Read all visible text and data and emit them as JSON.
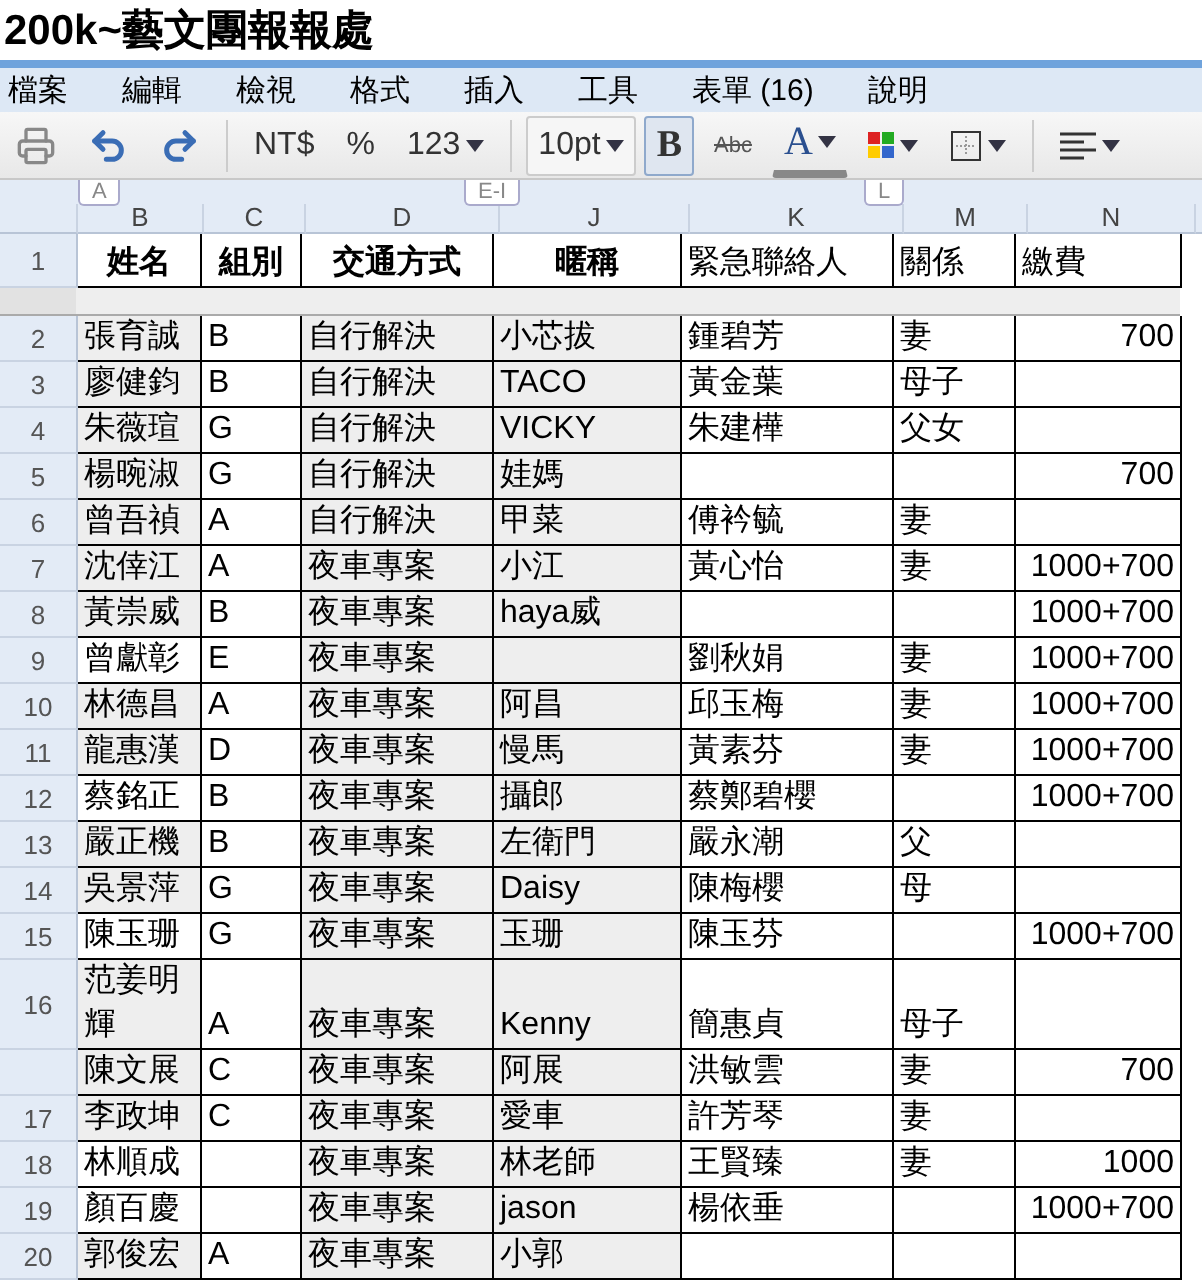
{
  "document_title": "200k~藝文團報報處",
  "menu": [
    "檔案",
    "編輯",
    "檢視",
    "格式",
    "插入",
    "工具",
    "表單 (16)",
    "說明"
  ],
  "toolbar": {
    "currency": "NT$",
    "percent": "%",
    "number_format": "123",
    "font_size": "10pt",
    "bold": {
      "label": "B",
      "selected": true
    },
    "strikethrough": "Abc",
    "text_color": "A"
  },
  "columns": [
    "B",
    "C",
    "D",
    "J",
    "K",
    "M",
    "N"
  ],
  "hidden_column_tabs": [
    "A",
    "E-I",
    "L"
  ],
  "header_row": {
    "number": "1",
    "cells": [
      {
        "text": "姓名",
        "bold": true
      },
      {
        "text": "組別",
        "bold": true
      },
      {
        "text": "交通方式",
        "bold": true
      },
      {
        "text": "暱稱",
        "bold": true
      },
      {
        "text": "緊急聯絡人",
        "bold": false
      },
      {
        "text": "關係",
        "bold": false
      },
      {
        "text": "繳費",
        "bold": false
      }
    ]
  },
  "rows": [
    {
      "number": "2",
      "name_shaded": true,
      "cells": [
        "張育誠",
        "B",
        "自行解決",
        "小芯拔",
        "鍾碧芳",
        "妻",
        "700"
      ]
    },
    {
      "number": "3",
      "name_shaded": true,
      "cells": [
        "廖健鈞",
        "B",
        "自行解決",
        "TACO",
        "黃金葉",
        "母子",
        null
      ]
    },
    {
      "number": "4",
      "name_shaded": true,
      "cells": [
        "朱薇瑄",
        "G",
        "自行解決",
        "VICKY",
        "朱建樺",
        "父女",
        null
      ]
    },
    {
      "number": "5",
      "name_shaded": true,
      "cells": [
        "楊晼淑",
        "G",
        "自行解決",
        "娃媽",
        null,
        null,
        "700"
      ]
    },
    {
      "number": "6",
      "name_shaded": true,
      "cells": [
        "曾吾禎",
        "A",
        "自行解決",
        "甲菜",
        "傅衿毓",
        "妻",
        null
      ]
    },
    {
      "number": "7",
      "name_shaded": true,
      "cells": [
        "沈倖江",
        "A",
        "夜車專案",
        "小江",
        "黃心怡",
        "妻",
        "1000+700"
      ]
    },
    {
      "number": "8",
      "name_shaded": true,
      "cells": [
        "黃崇威",
        "B",
        "夜車專案",
        "haya威",
        null,
        null,
        "1000+700"
      ]
    },
    {
      "number": "9",
      "name_shaded": false,
      "cells": [
        "曾獻彰",
        "E",
        "夜車專案",
        null,
        "劉秋娟",
        "妻",
        "1000+700"
      ]
    },
    {
      "number": "10",
      "name_shaded": true,
      "cells": [
        "林德昌",
        "A",
        "夜車專案",
        "阿昌",
        "邱玉梅",
        "妻",
        "1000+700"
      ]
    },
    {
      "number": "11",
      "name_shaded": true,
      "cells": [
        "龍惠漢",
        "D",
        "夜車專案",
        "慢馬",
        "黃素芬",
        "妻",
        "1000+700"
      ]
    },
    {
      "number": "12",
      "name_shaded": false,
      "cells": [
        "蔡銘正",
        "B",
        "夜車專案",
        "攝郎",
        "蔡鄭碧櫻",
        null,
        "1000+700"
      ]
    },
    {
      "number": "13",
      "name_shaded": true,
      "cells": [
        "嚴正機",
        "B",
        "夜車專案",
        "左衛門",
        "嚴永潮",
        "父",
        null
      ]
    },
    {
      "number": "14",
      "name_shaded": true,
      "cells": [
        "吳景萍",
        "G",
        "夜車專案",
        "Daisy",
        "陳梅櫻",
        "母",
        null
      ]
    },
    {
      "number": "15",
      "name_shaded": false,
      "cells": [
        "陳玉珊",
        "G",
        "夜車專案",
        "玉珊",
        "陳玉芬",
        null,
        "1000+700"
      ]
    },
    {
      "number": "16",
      "name_shaded": true,
      "cells": [
        "范姜明輝",
        "A",
        "夜車專案",
        "Kenny",
        "簡惠貞",
        "母子",
        null
      ]
    },
    {
      "name_shaded": true,
      "cells": [
        "陳文展",
        "C",
        "夜車專案",
        "阿展",
        "洪敏雲",
        "妻",
        "700"
      ]
    },
    {
      "number": "17",
      "name_shaded": true,
      "cells": [
        "李政坤",
        "C",
        "夜車專案",
        "愛車",
        "許芳琴",
        "妻",
        null
      ]
    },
    {
      "number": "18",
      "name_shaded": false,
      "cells": [
        "林順成",
        null,
        "夜車專案",
        "林老師",
        "王賢臻",
        "妻",
        "1000"
      ]
    },
    {
      "number": "19",
      "name_shaded": false,
      "cells": [
        "顏百慶",
        null,
        "夜車專案",
        "jason",
        "楊依垂",
        null,
        "1000+700"
      ]
    },
    {
      "number": "20",
      "name_shaded": true,
      "cells": [
        "郭俊宏",
        "A",
        "夜車專案",
        "小郭",
        null,
        null,
        null
      ]
    }
  ]
}
